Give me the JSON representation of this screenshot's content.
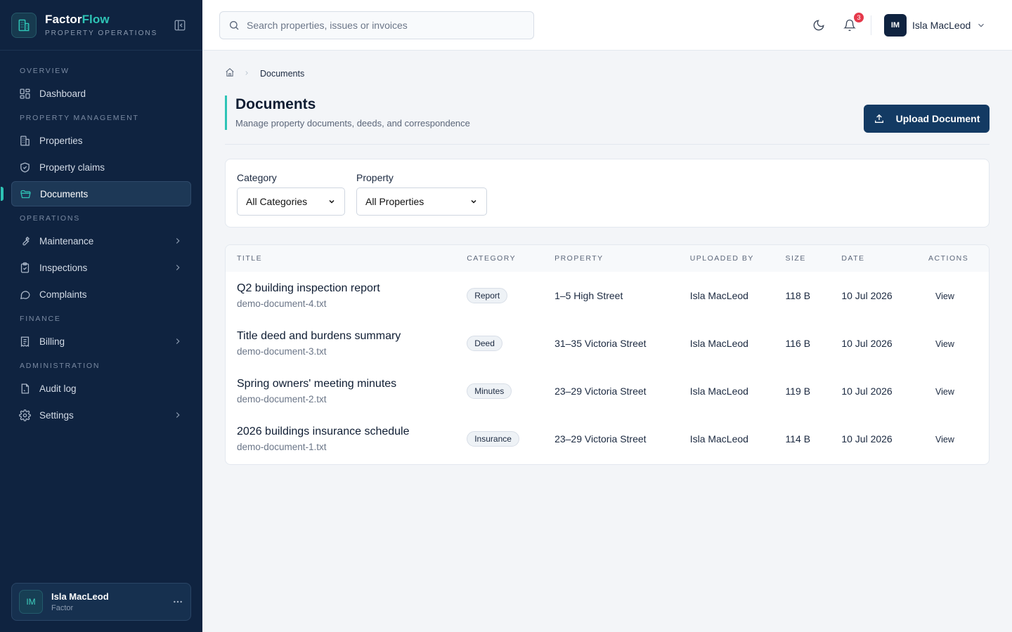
{
  "app": {
    "brand_part1": "Factor",
    "brand_part2": "Flow",
    "brand_sub": "PROPERTY OPERATIONS",
    "accent_color": "#2ec4b6",
    "sidebar_bg": "#0f2340"
  },
  "sidebar": {
    "sections": [
      {
        "label": "OVERVIEW"
      },
      {
        "label": "PROPERTY MANAGEMENT"
      },
      {
        "label": "OPERATIONS"
      },
      {
        "label": "FINANCE"
      },
      {
        "label": "ADMINISTRATION"
      }
    ],
    "items": [
      {
        "label": "Dashboard",
        "icon": "dashboard-icon"
      },
      {
        "label": "Properties",
        "icon": "building-icon"
      },
      {
        "label": "Property claims",
        "icon": "shield-icon"
      },
      {
        "label": "Documents",
        "icon": "folder-icon",
        "active": true
      },
      {
        "label": "Maintenance",
        "icon": "wrench-icon",
        "expandable": true
      },
      {
        "label": "Inspections",
        "icon": "clipboard-icon",
        "expandable": true
      },
      {
        "label": "Complaints",
        "icon": "chat-icon"
      },
      {
        "label": "Billing",
        "icon": "receipt-icon",
        "expandable": true
      },
      {
        "label": "Audit log",
        "icon": "file-icon"
      },
      {
        "label": "Settings",
        "icon": "gear-icon",
        "expandable": true
      }
    ],
    "user": {
      "initials": "IM",
      "name": "Isla MacLeod",
      "role": "Factor"
    }
  },
  "header": {
    "search_placeholder": "Search properties, issues or invoices",
    "notification_count": "3",
    "user_initials": "IM",
    "user_name": "Isla MacLeod"
  },
  "breadcrumb": {
    "current": "Documents"
  },
  "page": {
    "title": "Documents",
    "subtitle": "Manage property documents, deeds, and correspondence",
    "upload_label": "Upload Document"
  },
  "filters": {
    "category_label": "Category",
    "category_value": "All Categories",
    "property_label": "Property",
    "property_value": "All Properties"
  },
  "table": {
    "columns": [
      "TITLE",
      "CATEGORY",
      "PROPERTY",
      "UPLOADED BY",
      "SIZE",
      "DATE",
      "ACTIONS"
    ],
    "rows": [
      {
        "title": "Q2 building inspection report",
        "file": "demo-document-4.txt",
        "category": "Report",
        "property": "1–5 High Street",
        "uploaded_by": "Isla MacLeod",
        "size": "118 B",
        "date": "10 Jul 2026",
        "action": "View"
      },
      {
        "title": "Title deed and burdens summary",
        "file": "demo-document-3.txt",
        "category": "Deed",
        "property": "31–35 Victoria Street",
        "uploaded_by": "Isla MacLeod",
        "size": "116 B",
        "date": "10 Jul 2026",
        "action": "View"
      },
      {
        "title": "Spring owners' meeting minutes",
        "file": "demo-document-2.txt",
        "category": "Minutes",
        "property": "23–29 Victoria Street",
        "uploaded_by": "Isla MacLeod",
        "size": "119 B",
        "date": "10 Jul 2026",
        "action": "View"
      },
      {
        "title": "2026 buildings insurance schedule",
        "file": "demo-document-1.txt",
        "category": "Insurance",
        "property": "23–29 Victoria Street",
        "uploaded_by": "Isla MacLeod",
        "size": "114 B",
        "date": "10 Jul 2026",
        "action": "View"
      }
    ]
  }
}
